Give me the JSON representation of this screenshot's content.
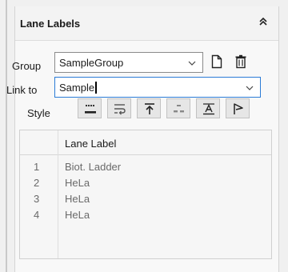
{
  "panel": {
    "title": "Lane Labels",
    "collapse_icon": "double-chevron-up-icon"
  },
  "group": {
    "label": "Group",
    "value": "SampleGroup",
    "new_icon": "new-document-icon",
    "delete_icon": "trash-icon"
  },
  "link_to": {
    "label": "Link to",
    "value": "Sample"
  },
  "style": {
    "label": "Style",
    "buttons": [
      {
        "name": "style-dots-underline-icon"
      },
      {
        "name": "style-wrap-icon"
      },
      {
        "name": "style-align-top-icon"
      },
      {
        "name": "style-dashed-icon"
      },
      {
        "name": "style-text-underline-icon"
      },
      {
        "name": "style-flag-icon"
      }
    ]
  },
  "table": {
    "column_header": "Lane Label",
    "rows": [
      {
        "num": "1",
        "label": "Biot. Ladder"
      },
      {
        "num": "2",
        "label": "HeLa"
      },
      {
        "num": "3",
        "label": "HeLa"
      },
      {
        "num": "4",
        "label": "HeLa"
      }
    ]
  },
  "colors": {
    "focus_border": "#2b7bd6",
    "row_text": "#6a6a6a"
  }
}
